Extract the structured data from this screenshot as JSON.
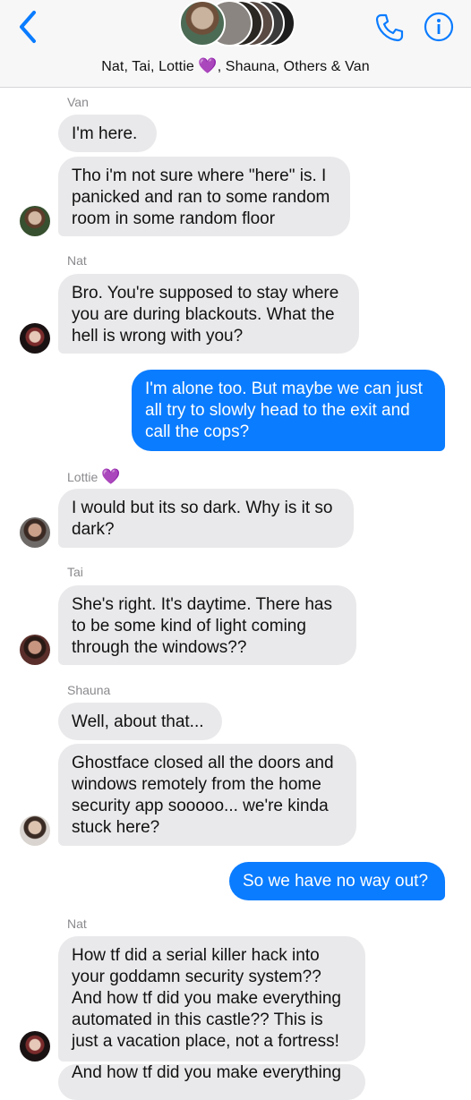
{
  "header": {
    "title_text": "Nat, Tai, Lottie ",
    "title_heart": "💜",
    "title_rest": ", Shauna, Others & Van",
    "back_icon": "chevron-left-icon",
    "call_icon": "phone-icon",
    "info_icon": "info-icon",
    "accent": "#0a7cff"
  },
  "messages": [
    {
      "sender": "Van"
    },
    {
      "text": "I'm here."
    },
    {
      "text": "Tho i'm not sure where \"here\" is. I panicked and ran to some random room in some random floor"
    },
    {
      "sender": "Nat"
    },
    {
      "text": "Bro. You're supposed to stay where you are during blackouts. What the hell is wrong with you?"
    },
    {
      "text": "I'm alone too. But maybe we can just all try to slowly head to the exit and call the cops?"
    },
    {
      "sender": "Lottie",
      "sender_heart": "💜"
    },
    {
      "text": "I would but its so dark. Why is it so dark?"
    },
    {
      "sender": "Tai"
    },
    {
      "text": "She's right. It's daytime. There has to be some kind of light coming through the windows??"
    },
    {
      "sender": "Shauna"
    },
    {
      "text": "Well, about that..."
    },
    {
      "text": "Ghostface closed all the doors and windows  remotely from the home security app sooooo... we're kinda stuck here?"
    },
    {
      "text": "So we have no way out?"
    },
    {
      "sender": "Nat"
    },
    {
      "text": "How tf did a serial killer hack into your goddamn security system?? And how tf did you make everything automated in this castle?? This is just a vacation place, not a fortress!"
    },
    {
      "text": "And how tf did you make everything"
    }
  ]
}
